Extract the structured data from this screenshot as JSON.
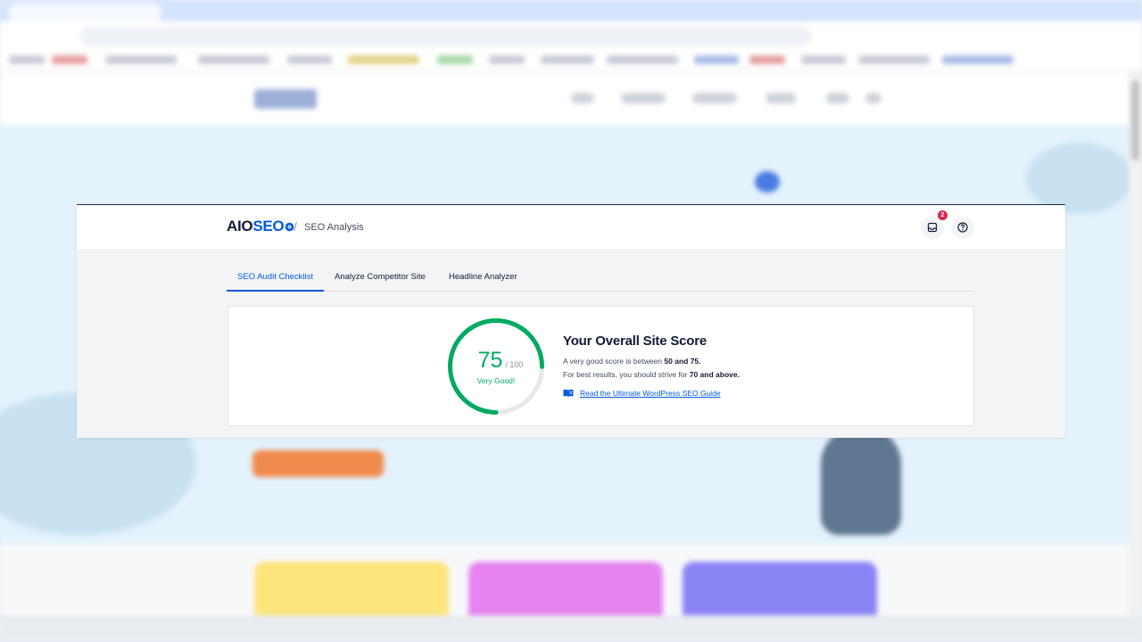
{
  "header": {
    "logo_aio": "AIO",
    "logo_seo": "SEO",
    "separator": "/",
    "breadcrumb": "SEO Analysis",
    "notification_count": "2"
  },
  "tabs": [
    {
      "label": "SEO Audit Checklist",
      "active": true
    },
    {
      "label": "Analyze Competitor Site",
      "active": false
    },
    {
      "label": "Headline Analyzer",
      "active": false
    }
  ],
  "score": {
    "value": "75",
    "max": "/ 100",
    "fraction": 0.75,
    "label": "Very Good!",
    "title": "Your Overall Site Score",
    "desc_prefix": "A very good score is between ",
    "desc_range": "50 and 75.",
    "desc2_prefix": "For best results, you should strive for ",
    "desc2_target": "70 and above.",
    "guide_link": "Read the Ultimate WordPress SEO Guide"
  },
  "colors": {
    "brand_blue": "#005ae0",
    "score_green": "#00aa63",
    "badge_red": "#df2a4a"
  },
  "icons": {
    "notifications": "inbox-icon",
    "help": "help-icon",
    "guide": "book-icon"
  }
}
